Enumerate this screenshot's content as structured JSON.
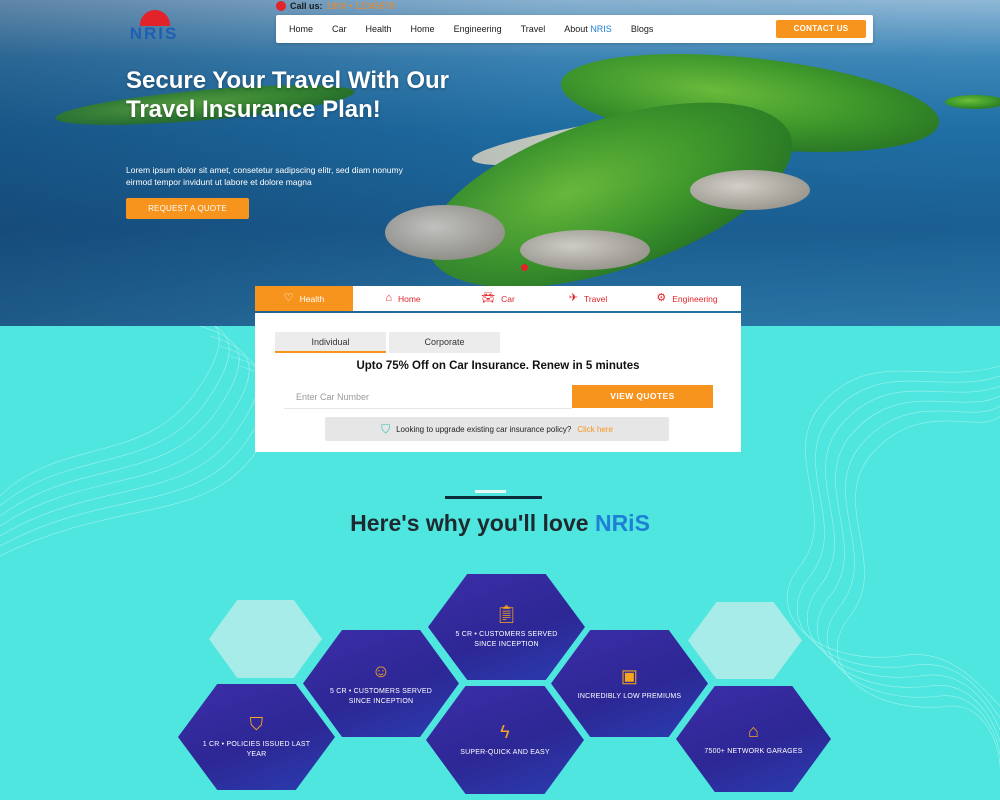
{
  "header": {
    "logo_text": "NRIS",
    "call_label": "Call us:",
    "call_number": "1800 • 12345678",
    "nav": [
      "Home",
      "Car",
      "Health",
      "Home",
      "Engineering",
      "Travel"
    ],
    "about_prefix": "About ",
    "about_brand": "NRIS",
    "blogs": "Blogs",
    "contact_button": "CONTACT US"
  },
  "hero": {
    "title": "Secure Your Travel With Our Travel Insurance Plan!",
    "subtitle": "Lorem ipsum dolor sit amet, consetetur sadipscing elitr, sed diam nonumy eirmod tempor invidunt ut labore et dolore magna",
    "cta": "REQUEST A QUOTE"
  },
  "category_tabs": [
    {
      "label": "Health",
      "icon": "health-icon",
      "active": true
    },
    {
      "label": "Home",
      "icon": "home-icon",
      "active": false
    },
    {
      "label": "Car",
      "icon": "car-icon",
      "active": false
    },
    {
      "label": "Travel",
      "icon": "plane-icon",
      "active": false
    },
    {
      "label": "Engineering",
      "icon": "engineering-icon",
      "active": false
    }
  ],
  "quote_panel": {
    "sub_tabs": [
      "Individual",
      "Corporate"
    ],
    "title": "Upto 75% Off on Car Insurance. Renew in 5 minutes",
    "input_placeholder": "Enter Car Number",
    "button": "VIEW QUOTES",
    "upgrade_text": "Looking to upgrade existing car insurance policy?",
    "upgrade_link": "Click here"
  },
  "why": {
    "title_prefix": "Here's why you'll love ",
    "title_brand": "NRiS",
    "features": [
      {
        "text": "5 CR • CUSTOMERS SERVED SINCE INCEPTION",
        "icon": "clipboard-icon"
      },
      {
        "text": "5 CR • CUSTOMERS SERVED SINCE INCEPTION",
        "icon": "smiley-icon"
      },
      {
        "text": "INCREDIBLY LOW PREMIUMS",
        "icon": "wallet-icon"
      },
      {
        "text": "1 CR • POLICIES ISSUED LAST YEAR",
        "icon": "shield-check-icon"
      },
      {
        "text": "SUPER-QUICK AND EASY",
        "icon": "lightning-doc-icon"
      },
      {
        "text": "7500+ NETWORK GARAGES",
        "icon": "garage-icon"
      }
    ]
  },
  "colors": {
    "accent": "#f7941e",
    "brand_blue": "#1d7fd6",
    "brand_red": "#e2242a",
    "teal_bg": "#4fe6df",
    "hex_purple": "#2d2795"
  }
}
